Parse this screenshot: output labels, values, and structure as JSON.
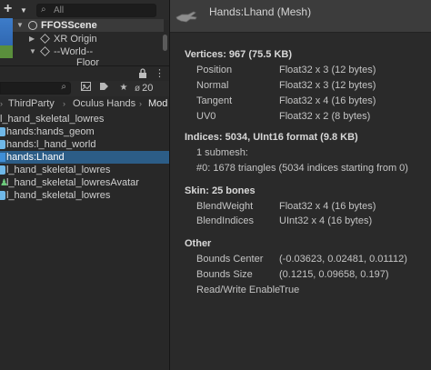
{
  "hierarchy": {
    "search_placeholder": "All",
    "items": [
      {
        "label": "FFOSScene"
      },
      {
        "label": "XR Origin"
      },
      {
        "label": "--World--"
      },
      {
        "label": "Floor"
      }
    ]
  },
  "project": {
    "hidden_count": "20",
    "breadcrumb": [
      "ThirdParty",
      "Oculus Hands",
      "Mod"
    ],
    "items": [
      {
        "label": "l_hand_skeletal_lowres",
        "icon": "prefab-icon"
      },
      {
        "label": "hands:hands_geom",
        "icon": "prefab-icon"
      },
      {
        "label": "hands:l_hand_world",
        "icon": "prefab-icon"
      },
      {
        "label": "hands:Lhand",
        "icon": "mesh-icon",
        "selected": true
      },
      {
        "label": "l_hand_skeletal_lowres",
        "icon": "prefab-icon"
      },
      {
        "label": "l_hand_skeletal_lowresAvatar",
        "icon": "avatar-icon"
      },
      {
        "label": "l_hand_skeletal_lowres",
        "icon": "prefab-icon"
      }
    ]
  },
  "inspector": {
    "title": "Hands:Lhand (Mesh)",
    "vertices": {
      "header": "Vertices: 967 (75.5 KB)",
      "rows": [
        {
          "key": "Position",
          "value": "Float32 x 3 (12 bytes)"
        },
        {
          "key": "Normal",
          "value": "Float32 x 3 (12 bytes)"
        },
        {
          "key": "Tangent",
          "value": "Float32 x 4 (16 bytes)"
        },
        {
          "key": "UV0",
          "value": "Float32 x 2 (8 bytes)"
        }
      ]
    },
    "indices": {
      "header": "Indices: 5034, UInt16 format (9.8 KB)",
      "lines": [
        "1 submesh:",
        "#0: 1678 triangles (5034 indices starting from 0)"
      ]
    },
    "skin": {
      "header": "Skin: 25 bones",
      "rows": [
        {
          "key": "BlendWeight",
          "value": "Float32 x 4 (16 bytes)"
        },
        {
          "key": "BlendIndices",
          "value": "UInt32 x 4 (16 bytes)"
        }
      ]
    },
    "other": {
      "header": "Other",
      "rows": [
        {
          "key": "Bounds Center",
          "value": "(-0.03623, 0.02481, 0.01112)"
        },
        {
          "key": "Bounds Size",
          "value": "(0.1215, 0.09658, 0.197)"
        },
        {
          "key": "Read/Write Enable",
          "value": "True"
        }
      ]
    }
  },
  "colors": {
    "selection": "#2c5d87",
    "panel": "#282828",
    "inspector_header": "#3c3c3c",
    "scene_blue": "#3d7cc9"
  }
}
